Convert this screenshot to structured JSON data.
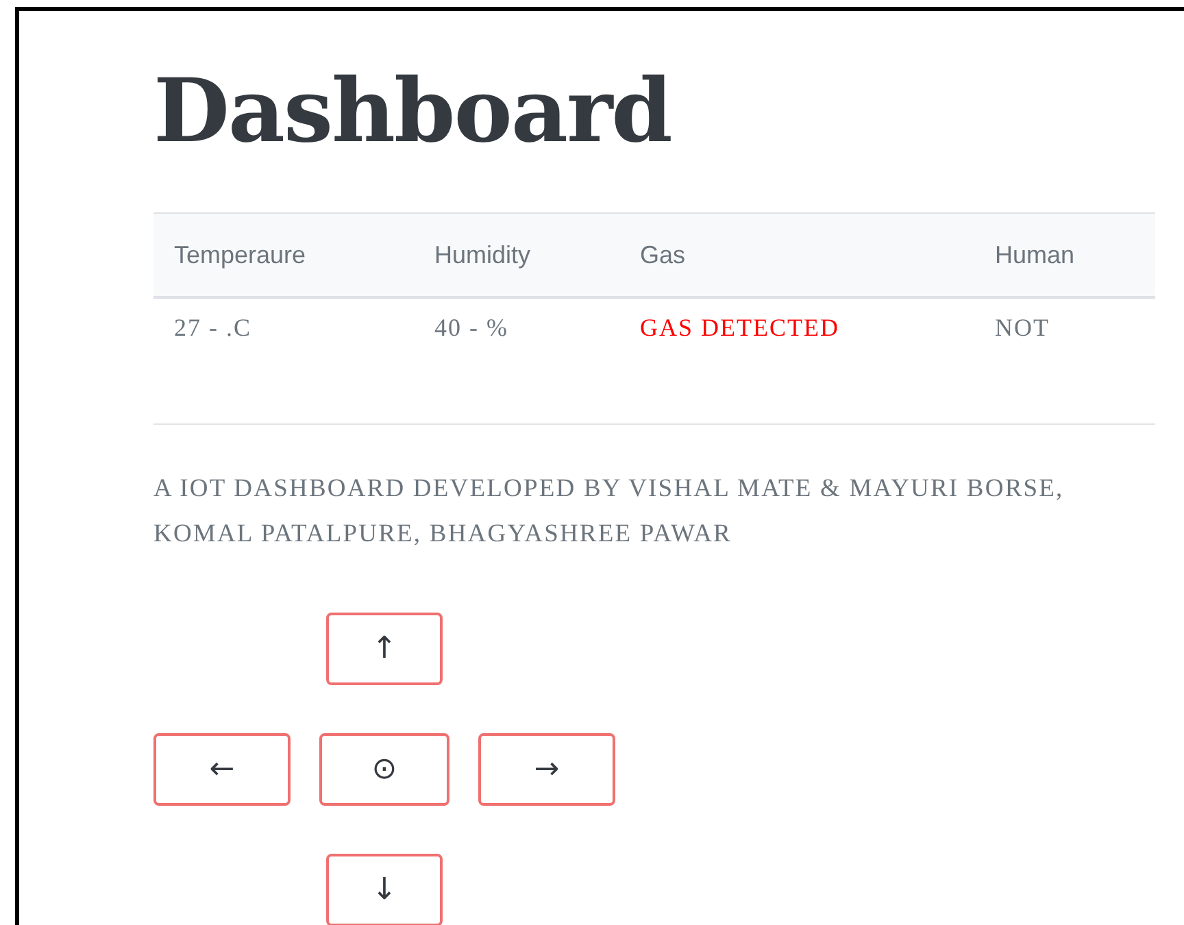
{
  "title": "Dashboard",
  "table": {
    "columns": [
      "Temperaure",
      "Humidity",
      "Gas",
      "Human"
    ],
    "rows": [
      {
        "cells": [
          {
            "text": "27 - .C",
            "alert": false
          },
          {
            "text": "40 - %",
            "alert": false
          },
          {
            "text": "GAS DETECTED",
            "alert": true
          },
          {
            "text": "NOT",
            "alert": false
          }
        ]
      }
    ]
  },
  "description": "A IOT DASHBOARD DEVELOPED BY VISHAL MATE & MAYURI BORSE, KOMAL PATALPURE, BHAGYASHREE PAWAR",
  "controls": [
    {
      "label": "↑",
      "kind": "up"
    },
    {
      "label": "←",
      "kind": "left"
    },
    {
      "label": "⊙",
      "kind": "stop"
    },
    {
      "label": "→",
      "kind": "right"
    },
    {
      "label": "↓",
      "kind": "down"
    }
  ]
}
